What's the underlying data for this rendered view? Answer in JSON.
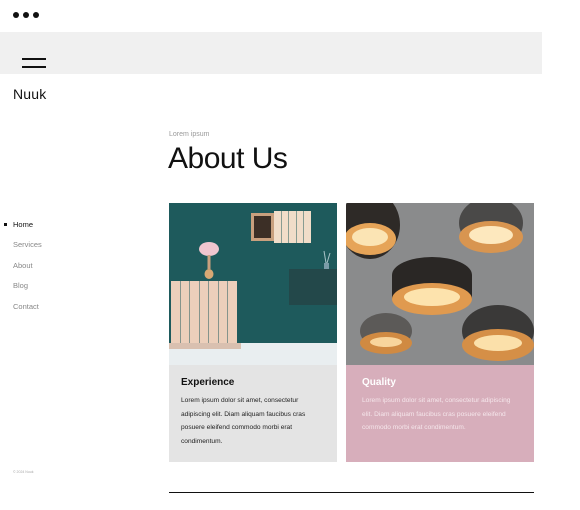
{
  "brand": "Nuuk",
  "nav": {
    "items": [
      {
        "label": "Home",
        "active": true
      },
      {
        "label": "Services",
        "active": false
      },
      {
        "label": "About",
        "active": false
      },
      {
        "label": "Blog",
        "active": false
      },
      {
        "label": "Contact",
        "active": false
      }
    ]
  },
  "copyright": "© 2024 Nuuk",
  "main": {
    "eyebrow": "Lorem ipsum",
    "title": "About Us",
    "cards": [
      {
        "title": "Experience",
        "body": "Lorem ipsum dolor sit amet, consectetur adipiscing elit. Diam aliquam faucibus cras posuere eleifend commodo morbi erat condimentum.",
        "background": "#e4e4e4",
        "image": "interior-wall-cabinet-lamp-image"
      },
      {
        "title": "Quality",
        "body": "Lorem ipsum dolor sit amet, consectetur adipiscing elit. Diam aliquam faucibus cras posuere eleifend commodo morbi erat condimentum.",
        "background": "#d7aebb",
        "image": "pendant-lamps-image"
      }
    ]
  },
  "colors": {
    "wall_teal": "#1e5a5c",
    "card_pink": "#d7aebb",
    "card_gray": "#e4e4e4",
    "topbar": "#f0f0f0"
  }
}
